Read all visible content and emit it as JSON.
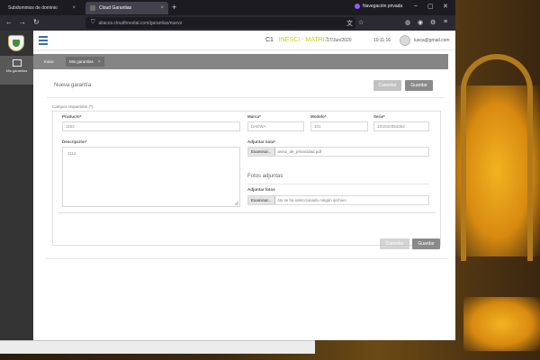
{
  "browser": {
    "tabs": [
      {
        "label": "Subdominios de dominio",
        "active": false
      },
      {
        "label": "Cloud Garantias",
        "active": true
      }
    ],
    "private_label": "Navegación privada",
    "url": "aliacos.cloudhnestal.com/garantias/nuevo"
  },
  "app": {
    "company": {
      "code": "C1",
      "name_part1": "INESCI",
      "separator": " - ",
      "name_part2": "MATRIZ"
    },
    "date": "17/Jun/2020",
    "time": "10:11:16",
    "user_email": "lusca@gmail.com",
    "sidebar": {
      "item_label": "Mis garantias"
    },
    "breadcrumbs": [
      {
        "label": "Inicio",
        "active": false
      },
      {
        "label": "Mis garantias",
        "active": true
      }
    ]
  },
  "form": {
    "title": "Nueva garantía",
    "cancel_label": "Cancelar",
    "save_label": "Guardar",
    "required_note": "Campos requeridos (*)",
    "producto": {
      "label": "Producto*",
      "value": "1153"
    },
    "marca": {
      "label": "Marca*",
      "value": "DAEWA"
    },
    "modelo": {
      "label": "Modelo*",
      "value": "101"
    },
    "serie": {
      "label": "Serie*",
      "value": "1D1510354354"
    },
    "descripcion": {
      "label": "Descripción*",
      "value": "1114"
    },
    "nota": {
      "label": "Adjuntar nota*",
      "browse": "Examinar...",
      "filename": "aviso_de_privacidad.pdf"
    },
    "fotos_title": "Fotos adjuntas",
    "fotos": {
      "label": "Adjuntar fotos",
      "browse": "Examinar...",
      "filename": "No se ha seleccionado ningún archivo"
    }
  },
  "colors": {
    "accent_brand": "#c4d400",
    "menu_blue": "#3c6fa8",
    "sidebar_dark": "#333333"
  }
}
